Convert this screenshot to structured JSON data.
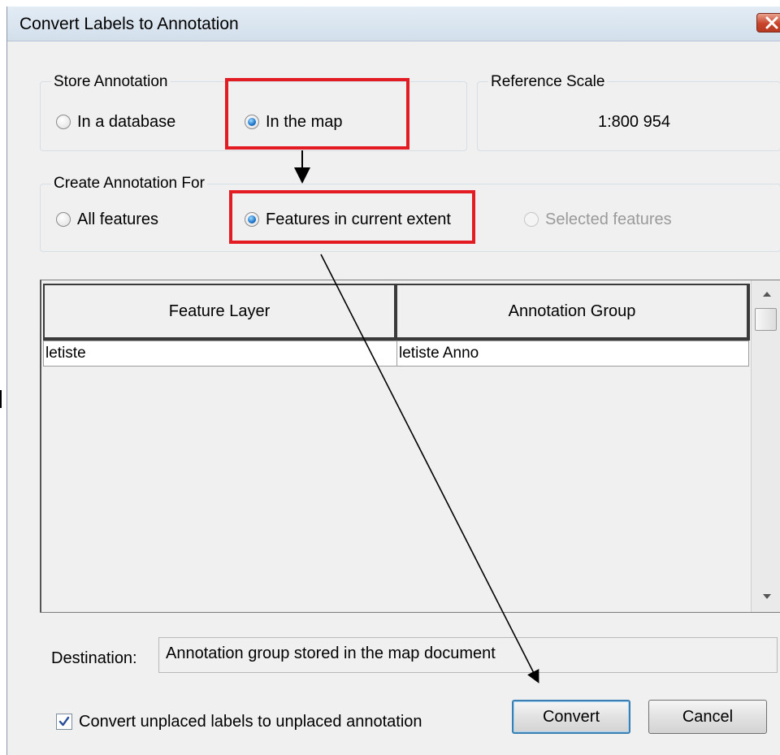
{
  "window": {
    "title": "Convert Labels to Annotation"
  },
  "store_annotation": {
    "label": "Store Annotation",
    "options": [
      "In a database",
      "In the map"
    ],
    "selected": "In the map"
  },
  "reference_scale": {
    "label": "Reference Scale",
    "value": "1:800 954"
  },
  "create_annotation_for": {
    "label": "Create Annotation For",
    "options": [
      "All features",
      "Features in current extent",
      "Selected features"
    ],
    "selected": "Features in current extent",
    "disabled": [
      "Selected features"
    ]
  },
  "table": {
    "columns": [
      "Feature Layer",
      "Annotation Group"
    ],
    "rows": [
      [
        "letiste",
        "letiste Anno"
      ]
    ]
  },
  "destination": {
    "label": "Destination:",
    "value": "Annotation group stored in the map document"
  },
  "convert_unplaced": {
    "label": "Convert unplaced labels to unplaced annotation",
    "checked": true
  },
  "buttons": {
    "convert": "Convert",
    "cancel": "Cancel"
  },
  "colors": {
    "highlight": "#e31b23",
    "titlebar": "#d9e4ef",
    "dialog_bg": "#f0f0f0",
    "close": "#c8432a"
  },
  "icons": {
    "close": "close-x-icon",
    "checkmark": "checkmark-icon"
  }
}
